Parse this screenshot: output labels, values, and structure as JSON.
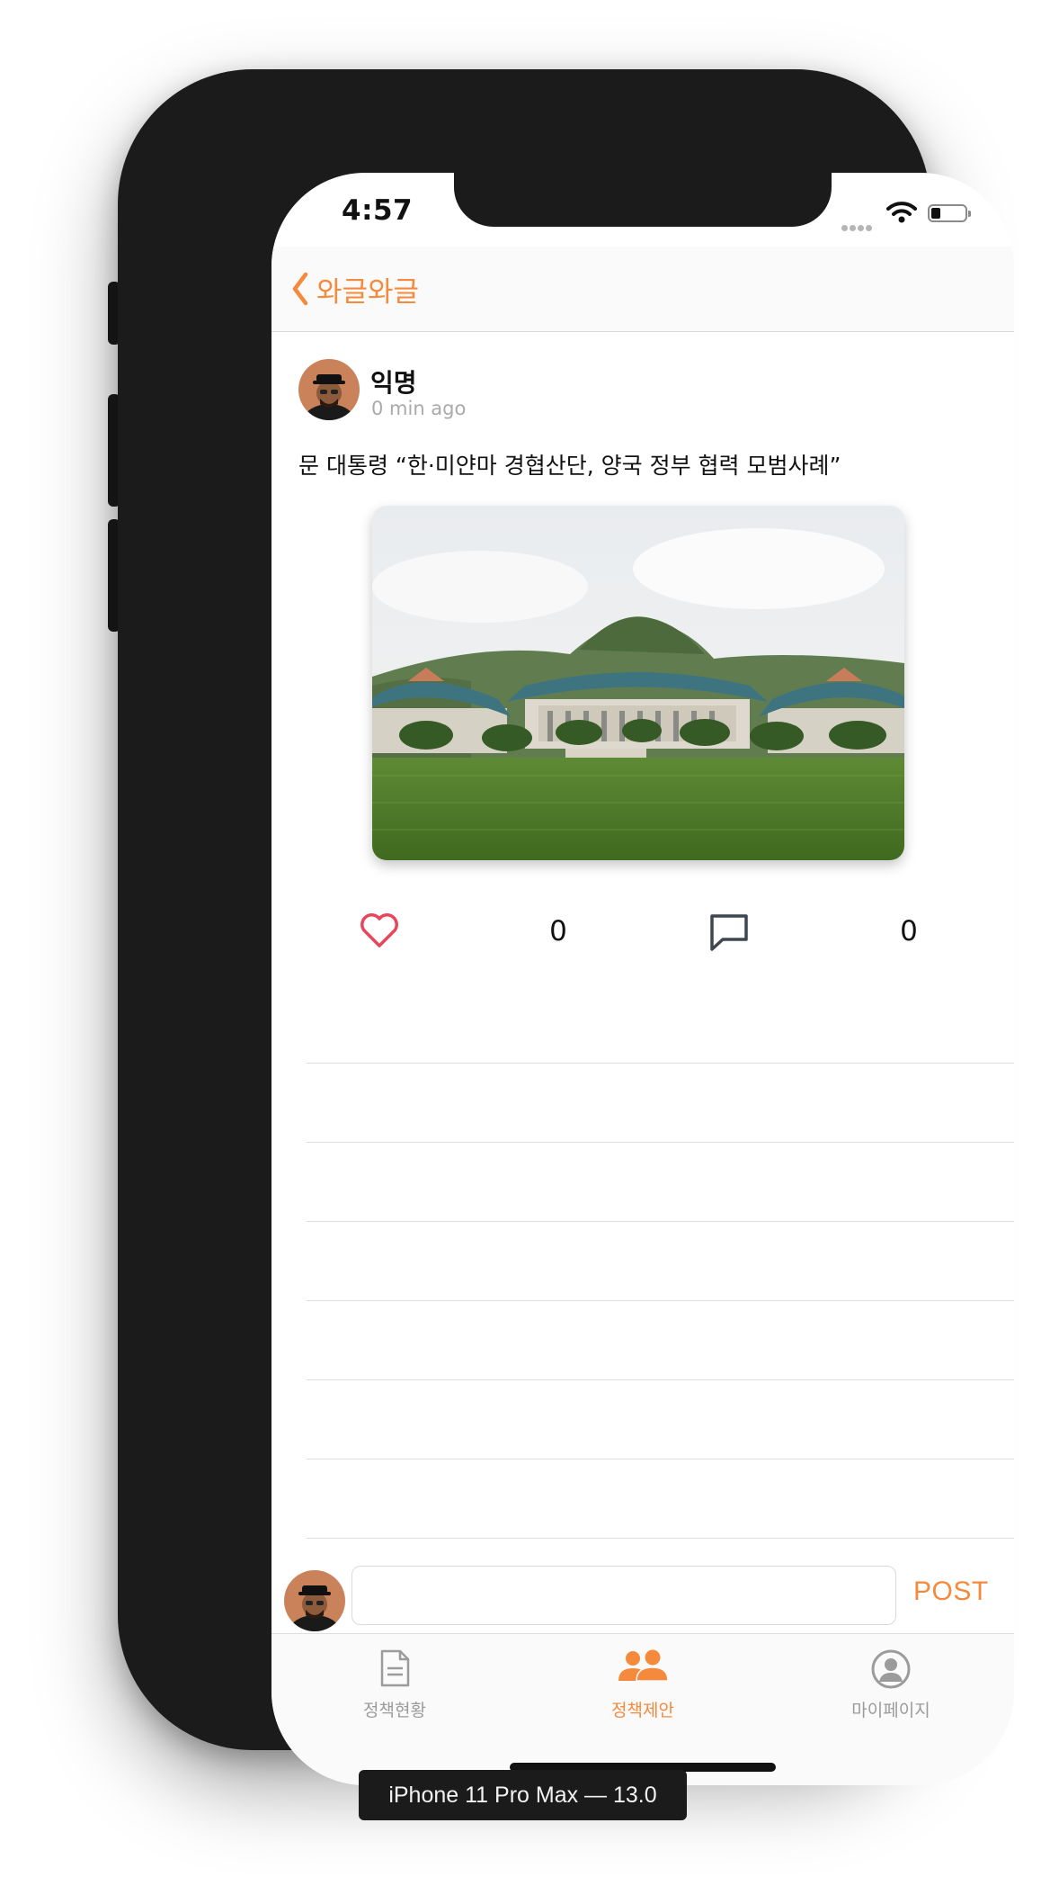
{
  "status_bar": {
    "time": "4:57"
  },
  "navbar": {
    "back_label": "와글와글",
    "back_icon": "chevron-left-icon"
  },
  "post": {
    "author": "익명",
    "time_ago": "0 min ago",
    "title": "문 대통령 “한·미얀마 경협산단, 양국 정부 협력 모범사례”",
    "image_subject": "palace-photo",
    "like_count": "0",
    "comment_count": "0"
  },
  "comments": {
    "rows": 6
  },
  "comment_input": {
    "value": "",
    "placeholder": "",
    "post_label": "POST"
  },
  "tabs": [
    {
      "label": "정책현황",
      "icon": "document-icon",
      "active": false
    },
    {
      "label": "정책제안",
      "icon": "people-icon",
      "active": true
    },
    {
      "label": "마이페이지",
      "icon": "profile-icon",
      "active": false
    }
  ],
  "simulator_label": "iPhone 11 Pro Max — 13.0",
  "colors": {
    "accent": "#f58a3c",
    "like": "#e8465b",
    "comment_icon": "#3e4650",
    "frame": "#1b1b1b"
  }
}
